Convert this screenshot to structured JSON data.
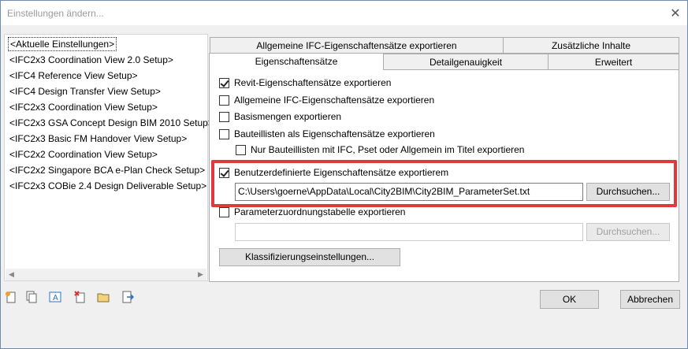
{
  "window": {
    "title": "Einstellungen ändern...",
    "close_glyph": "✕"
  },
  "setups": [
    "<Aktuelle Einstellungen>",
    "<IFC2x3 Coordination View 2.0 Setup>",
    "<IFC4 Reference View Setup>",
    "<IFC4 Design Transfer View Setup>",
    "<IFC2x3 Coordination View Setup>",
    "<IFC2x3 GSA Concept Design BIM 2010 Setup>",
    "<IFC2x3 Basic FM Handover View Setup>",
    "<IFC2x2 Coordination View Setup>",
    "<IFC2x2 Singapore BCA e-Plan Check Setup>",
    "<IFC2x3 COBie 2.4 Design Deliverable Setup>"
  ],
  "scroll": {
    "left": "◀",
    "right": "▶"
  },
  "tabs": {
    "row1": [
      "Allgemeine IFC-Eigenschaftensätze exportieren",
      "Zusätzliche Inhalte"
    ],
    "row2": [
      "Eigenschaftensätze",
      "Detailgenauigkeit",
      "Erweitert"
    ]
  },
  "options": {
    "revit_psets": "Revit-Eigenschaftensätze exportieren",
    "ifc_common_psets": "Allgemeine IFC-Eigenschaftensätze exportieren",
    "base_quantities": "Basismengen exportieren",
    "schedules_as_psets": "Bauteillisten als Eigenschaftensätze exportieren",
    "schedules_filter": "Nur Bauteillisten mit IFC, Pset oder Allgemein im Titel exportieren",
    "user_psets": "Benutzerdefinierte Eigenschaftensätze exportierem",
    "user_psets_path": "C:\\Users\\goerne\\AppData\\Local\\City2BIM\\City2BIM_ParameterSet.txt",
    "browse": "Durchsuchen...",
    "param_mapping": "Parameterzuordnungstabelle exportieren",
    "param_mapping_path": "",
    "browse2": "Durchsuchen...",
    "classification": "Klassifizierungseinstellungen..."
  },
  "toolbar_icons": [
    "new-setup-icon",
    "duplicate-setup-icon",
    "rename-setup-icon",
    "delete-setup-icon",
    "import-setup-icon",
    "export-setup-icon"
  ],
  "footer": {
    "ok": "OK",
    "cancel": "Abbrechen"
  },
  "colors": {
    "highlight": "#e0393e",
    "accent": "#2b6fc2"
  }
}
